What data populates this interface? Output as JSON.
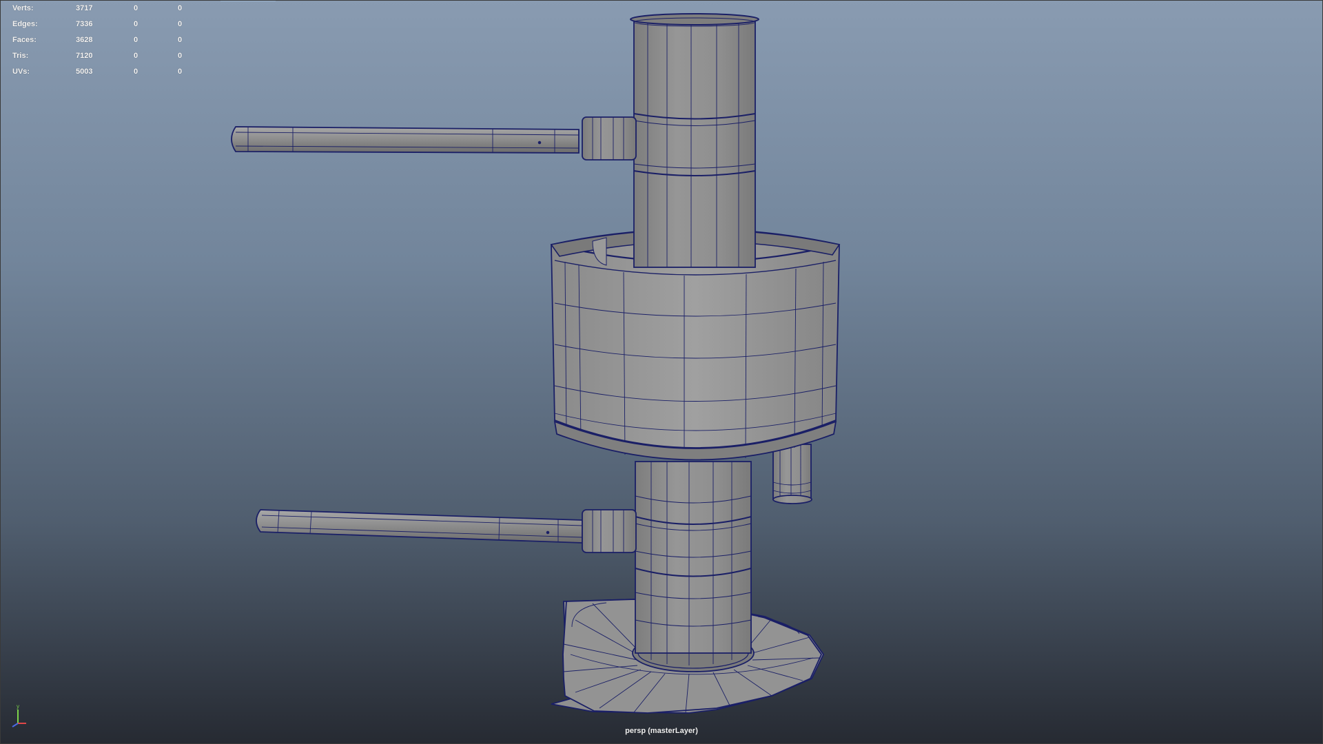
{
  "viewport": {
    "camera_label": "persp (masterLayer)"
  },
  "hud": {
    "rows": [
      {
        "label": "Verts:",
        "total": "3717",
        "selected": "0",
        "components": "0"
      },
      {
        "label": "Edges:",
        "total": "7336",
        "selected": "0",
        "components": "0"
      },
      {
        "label": "Faces:",
        "total": "3628",
        "selected": "0",
        "components": "0"
      },
      {
        "label": "Tris:",
        "total": "7120",
        "selected": "0",
        "components": "0"
      },
      {
        "label": "UVs:",
        "total": "5003",
        "selected": "0",
        "components": "0"
      }
    ]
  },
  "axis": {
    "y_label": "y",
    "x_label": "x",
    "z_label": "z"
  },
  "colors": {
    "bg_top": "#899bb1",
    "bg_bottom": "#262a32",
    "mesh_fill": "#8c8c8c",
    "wireframe": "#1a1f66",
    "hud_text": "#f4f4f4"
  },
  "icons": [
    "view-axis-icon"
  ]
}
